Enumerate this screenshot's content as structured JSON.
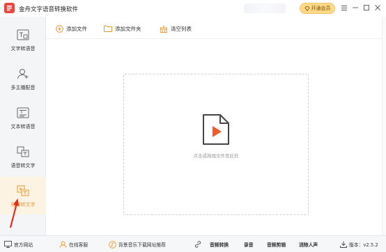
{
  "app": {
    "title": "金舟文字语音转换软件",
    "vip_label": "开通会员",
    "colors": {
      "accent": "#e89a2c",
      "brand_red": "#e8473b",
      "vip_gold": "#ffd98a"
    }
  },
  "window_controls": {
    "menu_icon": "menu-icon",
    "minimize_icon": "minimize-icon",
    "restore_icon": "restore-icon",
    "close_icon": "close-icon"
  },
  "sidebar": {
    "items": [
      {
        "label": "文字转语音",
        "icon": "text-to-speech-icon"
      },
      {
        "label": "多主播配音",
        "icon": "user-add-icon"
      },
      {
        "label": "文本转语音",
        "icon": "document-text-icon"
      },
      {
        "label": "语音转文字",
        "icon": "speech-to-text-icon"
      },
      {
        "label": "视频转文字",
        "icon": "video-to-text-icon",
        "active": true
      }
    ]
  },
  "toolbar": {
    "add_file": "添加文件",
    "add_folder": "添加文件夹",
    "clear_list": "清空列表"
  },
  "dropzone": {
    "hint": "点击或拖拽文件至此处"
  },
  "bottombar": {
    "official_site": "官方网站",
    "online_service": "在线客服",
    "music_download": "背景音乐下载网址推荐",
    "audio_convert": "音频转换",
    "record": "录音",
    "audio_edit": "音频剪辑",
    "vocal_remove": "消除人声",
    "version": "版本：v2.5.2"
  }
}
